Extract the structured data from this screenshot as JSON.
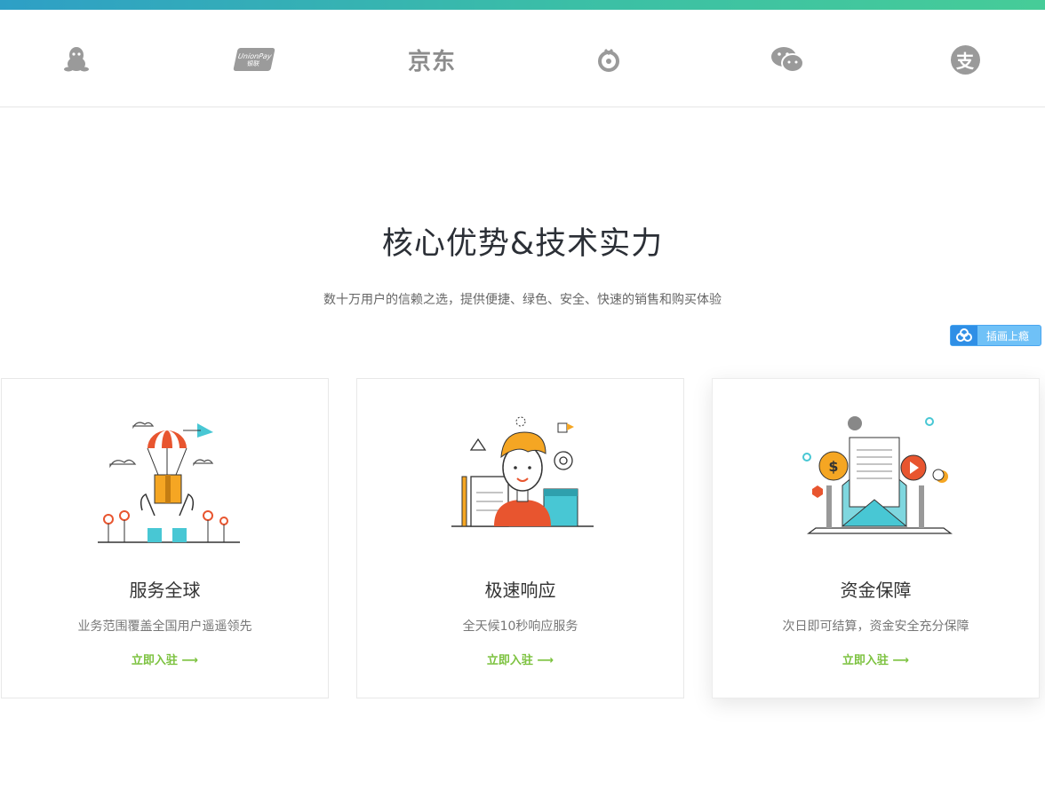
{
  "payment_logos": {
    "unionpay": {
      "line1": "UnionPay",
      "line2": "银联"
    },
    "jd": "京东",
    "alipay_glyph": "支"
  },
  "section": {
    "title": "核心优势&技术实力",
    "subtitle": "数十万用户的信赖之选，提供便捷、绿色、安全、快速的销售和购买体验"
  },
  "share_badge": {
    "label": "插画上瘾"
  },
  "cards": [
    {
      "title": "服务全球",
      "desc": "业务范围覆盖全国用户遥遥领先",
      "link": "立即入驻 ⟶"
    },
    {
      "title": "极速响应",
      "desc": "全天候10秒响应服务",
      "link": "立即入驻 ⟶"
    },
    {
      "title": "资金保障",
      "desc": "次日即可结算，资金安全充分保障",
      "link": "立即入驻 ⟶"
    }
  ],
  "colors": {
    "top_gradient_start": "#2e9fc6",
    "top_gradient_end": "#46cc98",
    "link_green": "#7cc23f",
    "logo_gray": "#9a9a9a"
  }
}
